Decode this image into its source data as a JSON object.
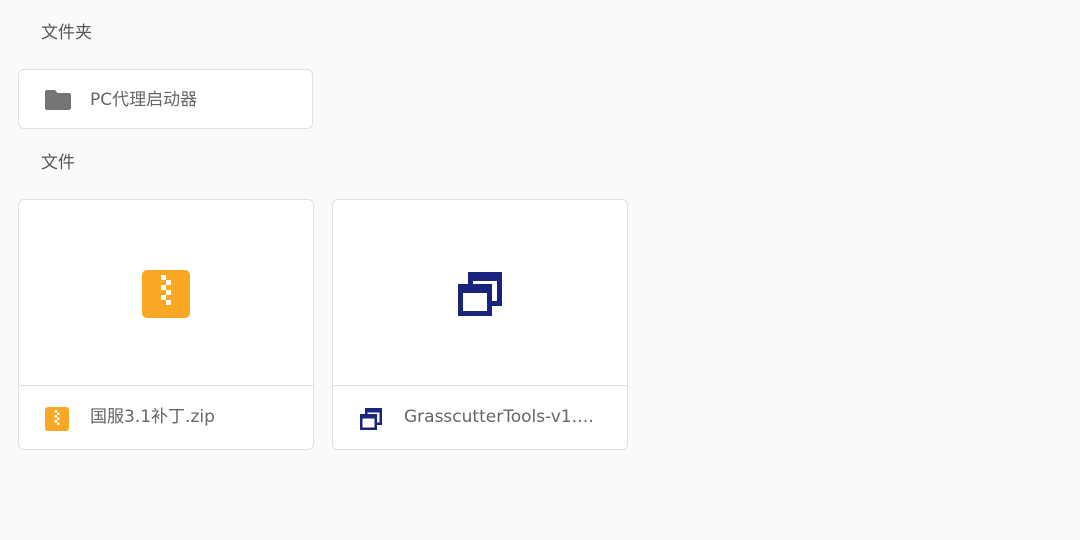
{
  "sections": {
    "folders_title": "文件夹",
    "files_title": "文件"
  },
  "folders": [
    {
      "name": "PC代理启动器",
      "icon": "folder-icon"
    }
  ],
  "files": [
    {
      "name": "国服3.1补丁.zip",
      "icon": "zip-file-icon",
      "icon_color": "#f9a825"
    },
    {
      "name": "GrasscutterTools-v1.6.…",
      "icon": "windows-app-icon",
      "icon_color": "#1a237e"
    }
  ],
  "colors": {
    "background": "#fafafa",
    "card_border": "#e0e0e0",
    "folder_icon": "#757575",
    "zip_icon": "#f9a825",
    "app_icon": "#1a237e"
  }
}
